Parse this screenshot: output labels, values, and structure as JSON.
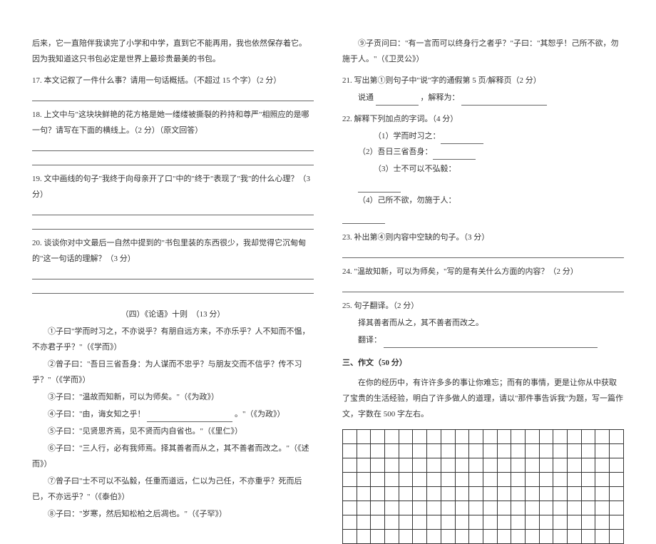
{
  "left": {
    "para1": "后来，它一直陪伴我读完了小学和中学，直到它不能再用，我也依然保存着它。因为我知道这只书包必定是世界上最珍贵最美的书包。",
    "q17": "17. 本文记叙了一件什么事？请用一句话概括。（不超过 15 个字）（2 分）",
    "q18": "18. 上文中与\"这块块鲜艳的花方格是她一缕缕被撕裂的矜持和尊严\"相照应的是哪一句？请写在下面的横线上。（2 分）（原文回答）",
    "q19": "19. 文中画线的句子\"我终于向母亲开了口\"中的\"终于\"表现了\"我\"的什么心理？（3 分）",
    "q20": "20. 谈谈你对中文最后一自然中提到的\"书包里装的东西很少，我却觉得它沉甸甸的\"这一句话的理解？（3 分）",
    "lunyu_title": "（四）《论语》十则　（13 分）",
    "l1": "①子曰\"学而时习之，不亦说乎？有朋自远方来，不亦乐乎？人不知而不愠，不亦君子乎？\"（《学而》）",
    "l2": "②曾子曰：\"吾日三省吾身：为人谋而不忠乎？与朋友交而不信乎？传不习乎？\"（《学而》）",
    "l3": "③子曰：\"温故而知新，可以为师矣。\"（《为政》）",
    "l4a": "④子曰：\"由，诲女知之乎！",
    "l4b": "。\"（《为政》）",
    "l5": "⑤子曰：\"见贤思齐焉，见不贤而内自省也。\"（《里仁》）",
    "l6": "⑥子曰：\"三人行，必有我师焉。择其善者而从之，其不善者而改之。\"（《述而》）",
    "l7": "⑦曾子曰\"士不可以不弘毅，任重而道远，仁以为己任，不亦重乎？死而后已，不亦远乎？\"（《泰伯》）",
    "l8": "⑧子曰：\"岁寒，然后知松柏之后凋也。\"（《子罕》）"
  },
  "right": {
    "l9": "⑨子贡问曰：\"有一言而可以终身行之者乎？\"子曰：\"其恕乎！己所不欲，勿施于人。\"（《卫灵公》）",
    "q21": "21. 写出第①则句子中\"说\"字的通假第 5 页/解释页（2 分）",
    "q21_a": "说通",
    "q21_b": "，解释为：",
    "q22": "22. 解释下列加点的字词。（4 分）",
    "q22_1": "（1）学而时习之：",
    "q22_2": "（2）吾日三省吾身：",
    "q22_3": "（3）士不可以不弘毅：",
    "q22_4": "（4）己所不欲，勿施于人：",
    "q23": "23. 补出第④则内容中空缺的句子。（3 分）",
    "q24": "24. \"温故知新，可以为师矣，\"写的是有关什么方面的内容？（2 分）",
    "q25": "25. 句子翻译。（2 分）",
    "q25_text": "择其善者而从之，其不善者而改之。",
    "q25_label": "翻译：",
    "essay_title": "三、作文（50 分）",
    "essay_prompt": "在你的经历中，有许许多多的事让你难忘；而有的事情，更是让你从中获取了宝贵的生活经验，明白了许多做人的道理，请以\"那件事告诉我\"为题，写一篇作文，字数在 500 字左右。"
  },
  "chart_data": {
    "type": "table",
    "description": "Empty composition writing grid",
    "rows": 8,
    "cols": 20,
    "cells_filled": 0
  }
}
